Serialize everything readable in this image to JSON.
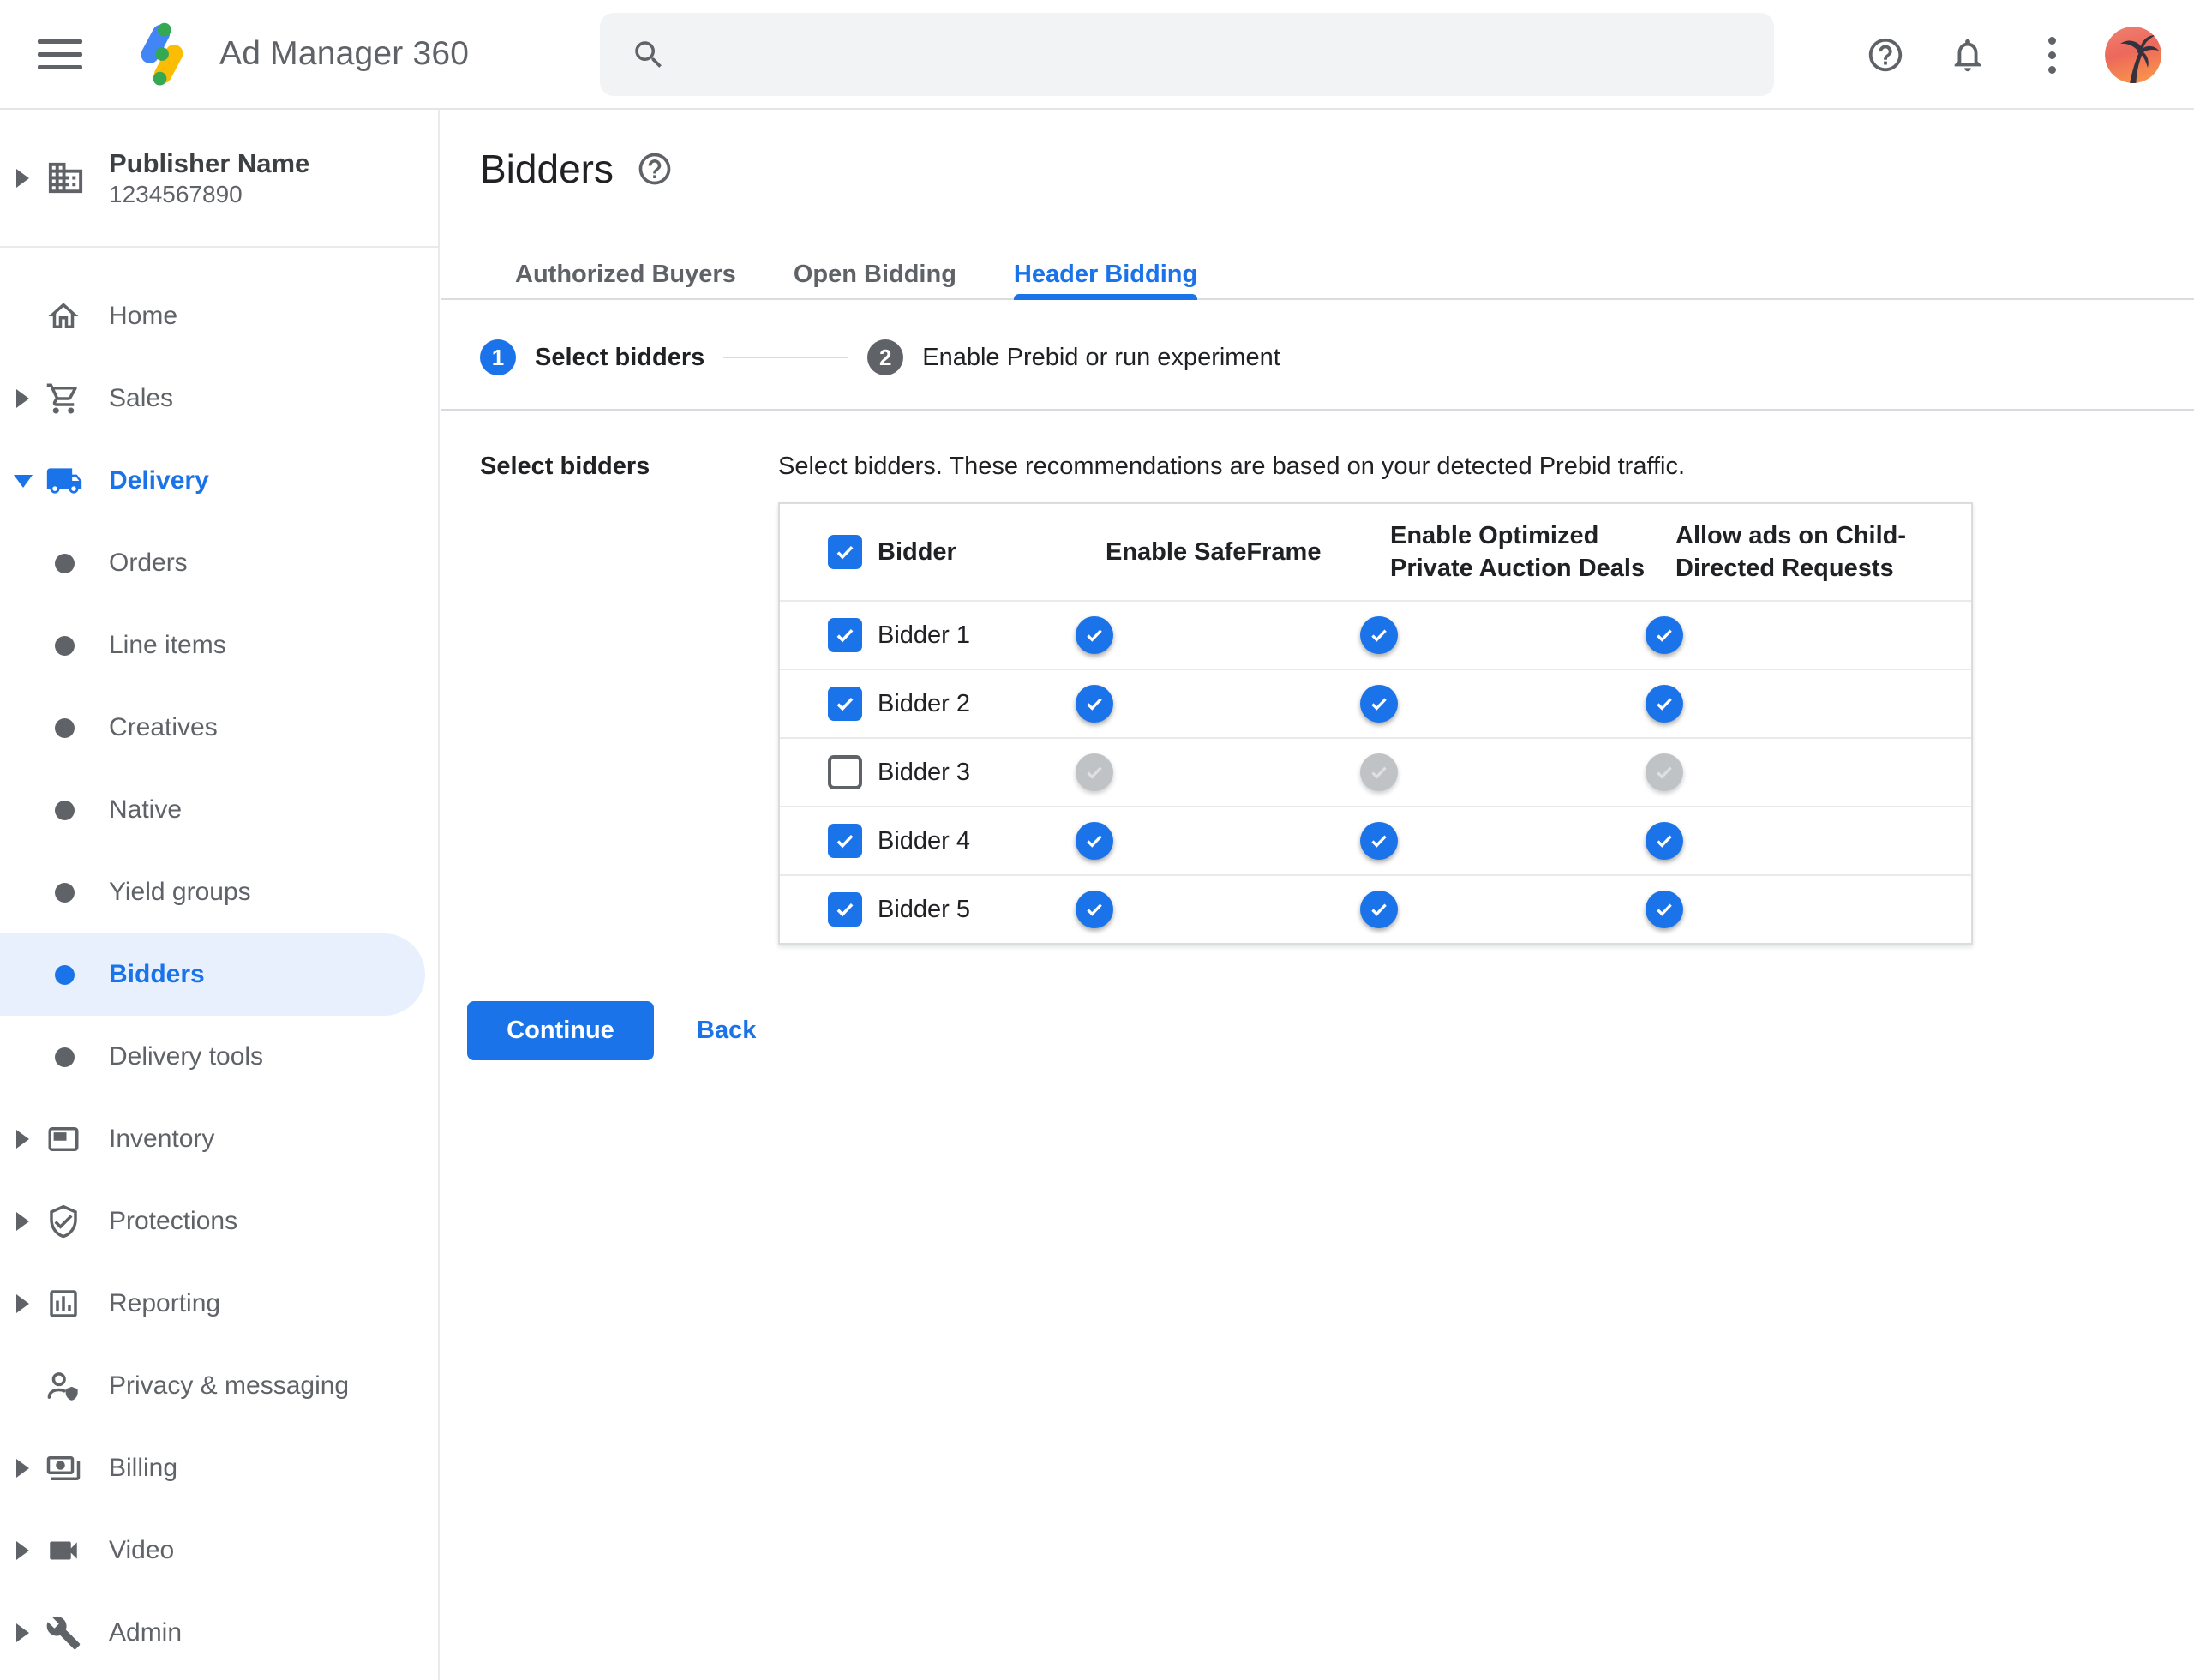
{
  "colors": {
    "accent": "#1a73e8",
    "toggle_track_on": "#8ab4f8",
    "selected_item_bg": "#e8f0fe",
    "text_primary": "#202124",
    "text_muted": "#5f6368",
    "border": "#dadce0",
    "search_bg": "#f1f3f4"
  },
  "topbar": {
    "app_title": "Ad Manager 360",
    "search_placeholder": "",
    "icons": [
      "menu-icon",
      "ad-manager-logo",
      "search-icon",
      "help-icon",
      "notifications-icon",
      "more-vert-icon",
      "avatar"
    ]
  },
  "sidebar": {
    "publisher": {
      "name": "Publisher Name",
      "id": "1234567890",
      "icon": "building-icon"
    },
    "items": [
      {
        "label": "Home",
        "icon": "home-icon"
      },
      {
        "label": "Sales",
        "icon": "cart-icon",
        "expandable": true
      },
      {
        "label": "Delivery",
        "icon": "truck-icon",
        "expandable": true,
        "expanded": true,
        "active": true
      },
      {
        "label": "Orders",
        "icon": "bullet"
      },
      {
        "label": "Line items",
        "icon": "bullet"
      },
      {
        "label": "Creatives",
        "icon": "bullet"
      },
      {
        "label": "Native",
        "icon": "bullet"
      },
      {
        "label": "Yield groups",
        "icon": "bullet"
      },
      {
        "label": "Bidders",
        "icon": "bullet",
        "active": true,
        "selected": true
      },
      {
        "label": "Delivery tools",
        "icon": "bullet"
      },
      {
        "label": "Inventory",
        "icon": "ad-unit-icon",
        "expandable": true
      },
      {
        "label": "Protections",
        "icon": "shield-check-icon",
        "expandable": true
      },
      {
        "label": "Reporting",
        "icon": "bar-chart-icon",
        "expandable": true
      },
      {
        "label": "Privacy & messaging",
        "icon": "person-shield-icon"
      },
      {
        "label": "Billing",
        "icon": "payments-icon",
        "expandable": true
      },
      {
        "label": "Video",
        "icon": "videocam-icon",
        "expandable": true
      },
      {
        "label": "Admin",
        "icon": "wrench-icon",
        "expandable": true
      }
    ]
  },
  "main": {
    "title": "Bidders",
    "title_help_icon": "help-icon",
    "tabs": [
      {
        "label": "Authorized Buyers",
        "active": false
      },
      {
        "label": "Open Bidding",
        "active": false
      },
      {
        "label": "Header Bidding",
        "active": true
      }
    ],
    "stepper": [
      {
        "number": "1",
        "label": "Select bidders",
        "state": "current"
      },
      {
        "number": "2",
        "label": "Enable Prebid or run experiment",
        "state": "upcoming"
      }
    ],
    "section_label": "Select bidders",
    "description": "Select bidders. These recommendations are based on your detected Prebid traffic.",
    "table": {
      "select_all_checked": true,
      "headers": [
        "Bidder",
        "Enable SafeFrame",
        "Enable Optimized Private Auction Deals",
        "Allow ads on Child-Directed Requests"
      ],
      "rows": [
        {
          "name": "Bidder 1",
          "selected": true,
          "safeframe": true,
          "optimized_deals": true,
          "child_directed": true
        },
        {
          "name": "Bidder 2",
          "selected": true,
          "safeframe": true,
          "optimized_deals": true,
          "child_directed": true
        },
        {
          "name": "Bidder 3",
          "selected": false,
          "safeframe": false,
          "optimized_deals": false,
          "child_directed": false
        },
        {
          "name": "Bidder 4",
          "selected": true,
          "safeframe": true,
          "optimized_deals": true,
          "child_directed": true
        },
        {
          "name": "Bidder 5",
          "selected": true,
          "safeframe": true,
          "optimized_deals": true,
          "child_directed": true
        }
      ]
    },
    "actions": {
      "continue_label": "Continue",
      "back_label": "Back"
    }
  }
}
